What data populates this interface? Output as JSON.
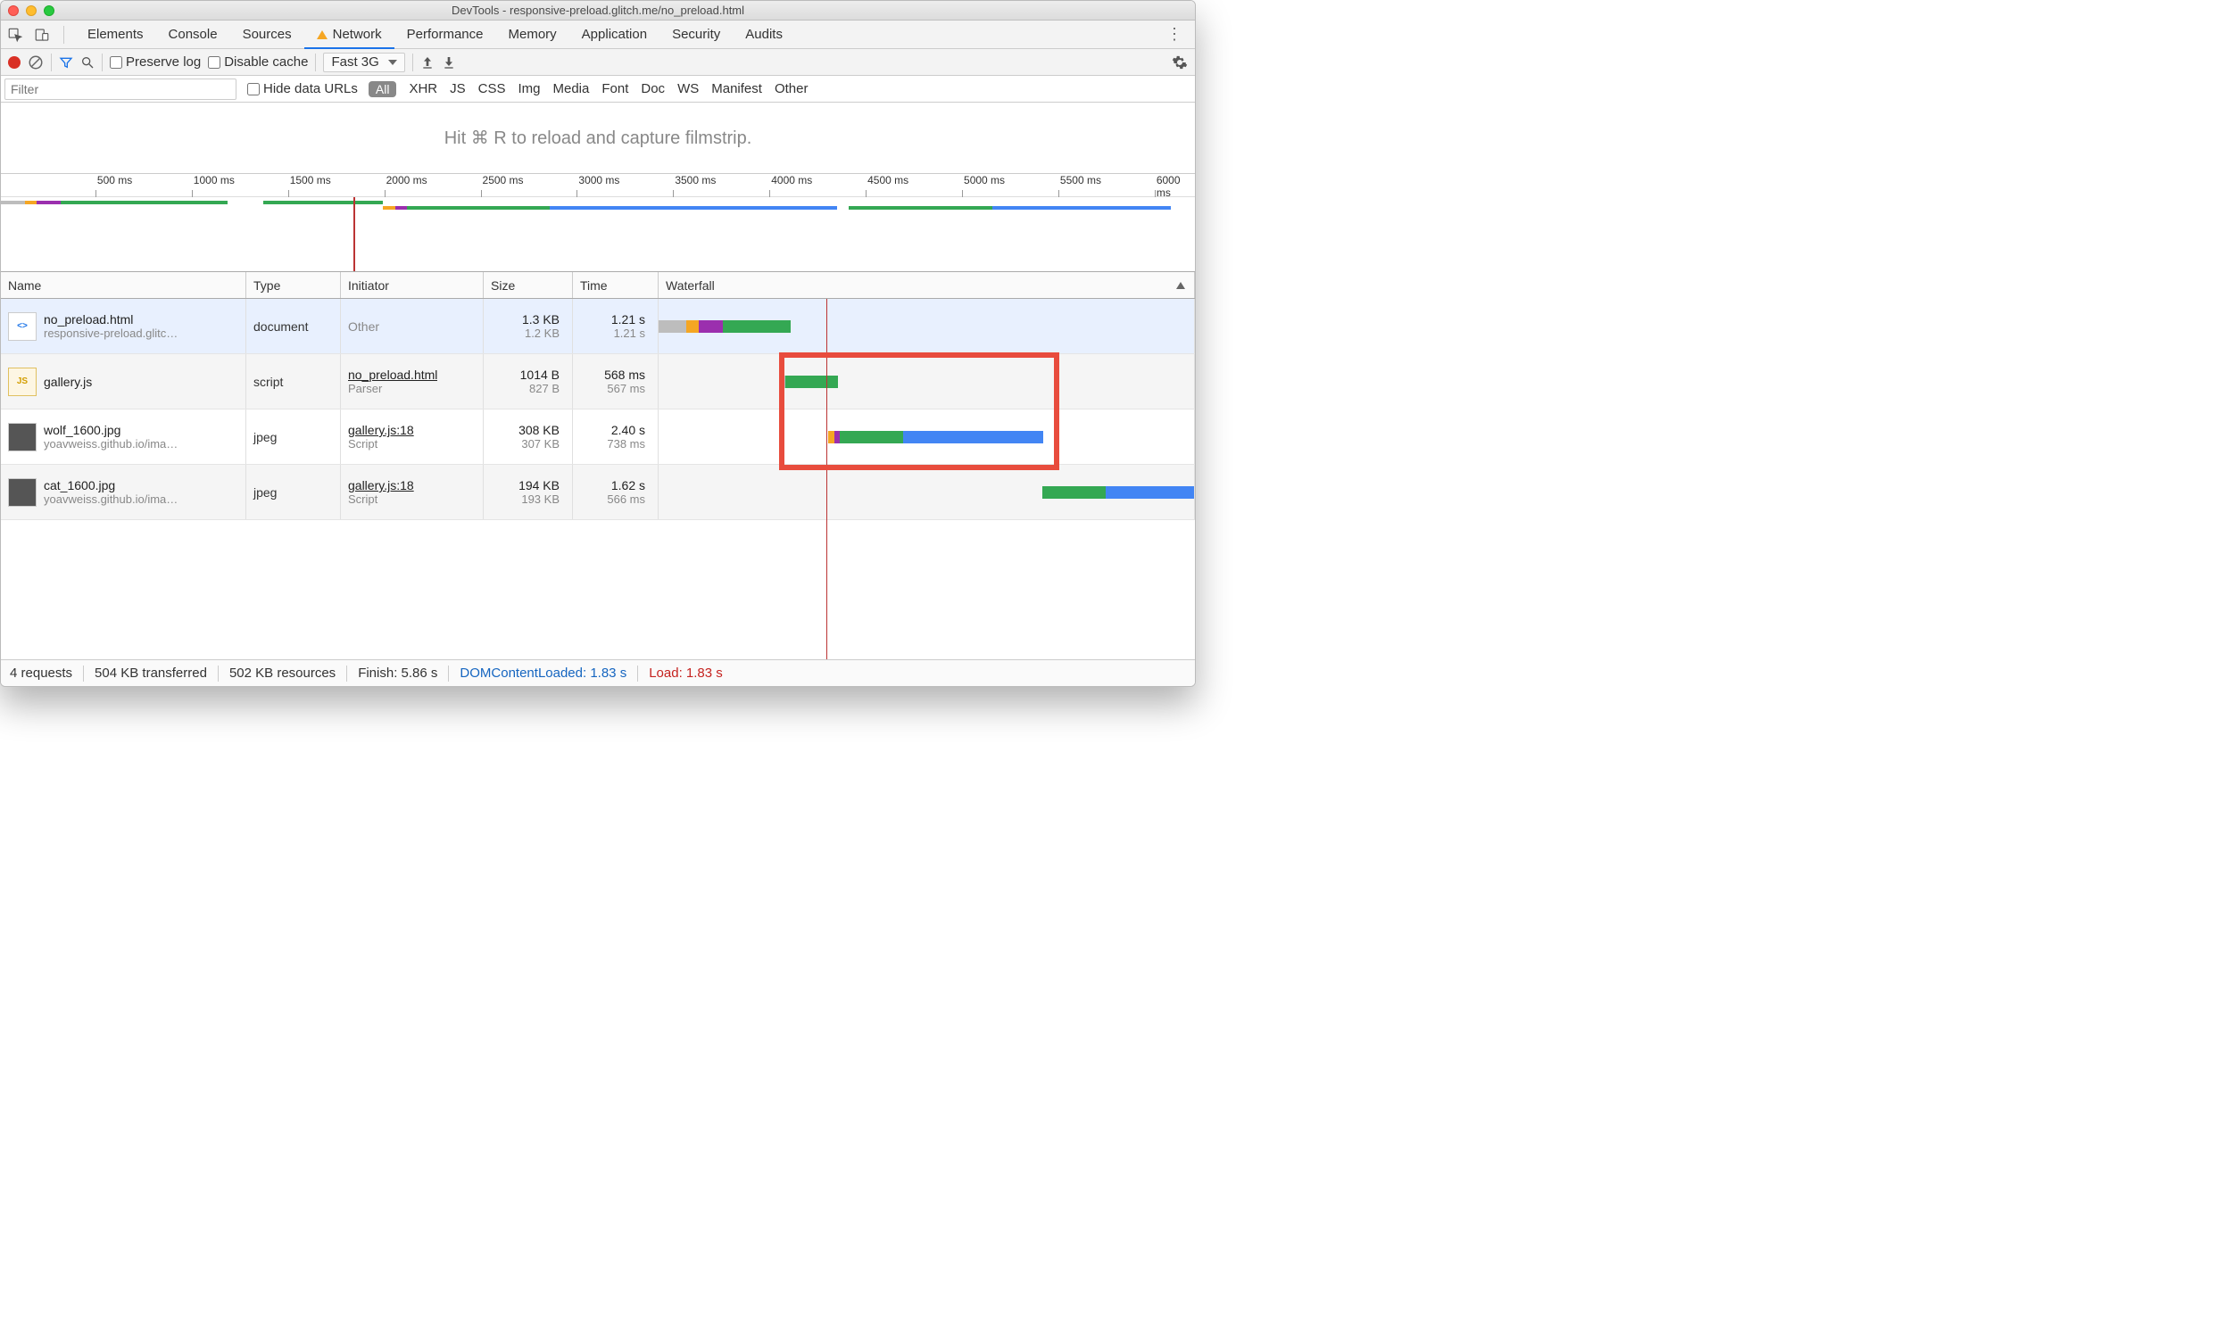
{
  "window": {
    "title": "DevTools - responsive-preload.glitch.me/no_preload.html"
  },
  "tabs": {
    "items": [
      "Elements",
      "Console",
      "Sources",
      "Network",
      "Performance",
      "Memory",
      "Application",
      "Security",
      "Audits"
    ],
    "active": "Network",
    "warn_on": "Network"
  },
  "toolbar": {
    "preserve_log": "Preserve log",
    "disable_cache": "Disable cache",
    "throttling": "Fast 3G"
  },
  "filters": {
    "placeholder": "Filter",
    "hide_data_urls": "Hide data URLs",
    "categories": [
      "All",
      "XHR",
      "JS",
      "CSS",
      "Img",
      "Media",
      "Font",
      "Doc",
      "WS",
      "Manifest",
      "Other"
    ],
    "active": "All"
  },
  "filmstrip_hint": "Hit ⌘ R to reload and capture filmstrip.",
  "overview": {
    "ticks": [
      "500 ms",
      "1000 ms",
      "1500 ms",
      "2000 ms",
      "2500 ms",
      "3000 ms",
      "3500 ms",
      "4000 ms",
      "4500 ms",
      "5000 ms",
      "5500 ms",
      "6000 ms"
    ],
    "load_ms": 1830,
    "range_ms": 6200
  },
  "columns": {
    "name": "Name",
    "type": "Type",
    "initiator": "Initiator",
    "size": "Size",
    "time": "Time",
    "waterfall": "Waterfall"
  },
  "requests": [
    {
      "name": "no_preload.html",
      "subtitle": "responsive-preload.glitc…",
      "type": "document",
      "initiator": "Other",
      "initiator_sub": "",
      "size": "1.3 KB",
      "size2": "1.2 KB",
      "time": "1.21 s",
      "time2": "1.21 s",
      "icon": "html",
      "selected": true,
      "wf": [
        {
          "start": 0,
          "len": 70,
          "color": "#bdbdbd"
        },
        {
          "start": 70,
          "len": 30,
          "color": "#f5a623"
        },
        {
          "start": 100,
          "len": 60,
          "color": "#9b2fae"
        },
        {
          "start": 160,
          "len": 170,
          "color": "#34a853"
        }
      ]
    },
    {
      "name": "gallery.js",
      "subtitle": "",
      "type": "script",
      "initiator": "no_preload.html",
      "initiator_sub": "Parser",
      "size": "1014 B",
      "size2": "827 B",
      "time": "568 ms",
      "time2": "567 ms",
      "icon": "js",
      "wf": [
        {
          "start": 310,
          "len": 8,
          "color": "#bdbdbd"
        },
        {
          "start": 318,
          "len": 130,
          "color": "#34a853"
        }
      ]
    },
    {
      "name": "wolf_1600.jpg",
      "subtitle": "yoavweiss.github.io/ima…",
      "type": "jpeg",
      "initiator": "gallery.js:18",
      "initiator_sub": "Script",
      "size": "308 KB",
      "size2": "307 KB",
      "time": "2.40 s",
      "time2": "738 ms",
      "icon": "img",
      "wf": [
        {
          "start": 425,
          "len": 14,
          "color": "#f5a623"
        },
        {
          "start": 439,
          "len": 14,
          "color": "#9b2fae"
        },
        {
          "start": 453,
          "len": 160,
          "color": "#34a853"
        },
        {
          "start": 613,
          "len": 350,
          "color": "#4285f4"
        }
      ]
    },
    {
      "name": "cat_1600.jpg",
      "subtitle": "yoavweiss.github.io/ima…",
      "type": "jpeg",
      "initiator": "gallery.js:18",
      "initiator_sub": "Script",
      "size": "194 KB",
      "size2": "193 KB",
      "time": "1.62 s",
      "time2": "566 ms",
      "icon": "img",
      "wf": [
        {
          "start": 960,
          "len": 160,
          "color": "#34a853"
        },
        {
          "start": 1120,
          "len": 220,
          "color": "#4285f4"
        }
      ]
    }
  ],
  "status": {
    "req": "4 requests",
    "transferred": "504 KB transferred",
    "resources": "502 KB resources",
    "finish": "Finish: 5.86 s",
    "dcl": "DOMContentLoaded: 1.83 s",
    "load": "Load: 1.83 s"
  },
  "highlight": {
    "row_start": 1,
    "row_end": 2
  },
  "colors": {
    "green": "#34a853",
    "blue": "#4285f4",
    "orange": "#f5a623",
    "purple": "#9b2fae",
    "grey": "#bdbdbd",
    "red": "#e84c3d"
  }
}
